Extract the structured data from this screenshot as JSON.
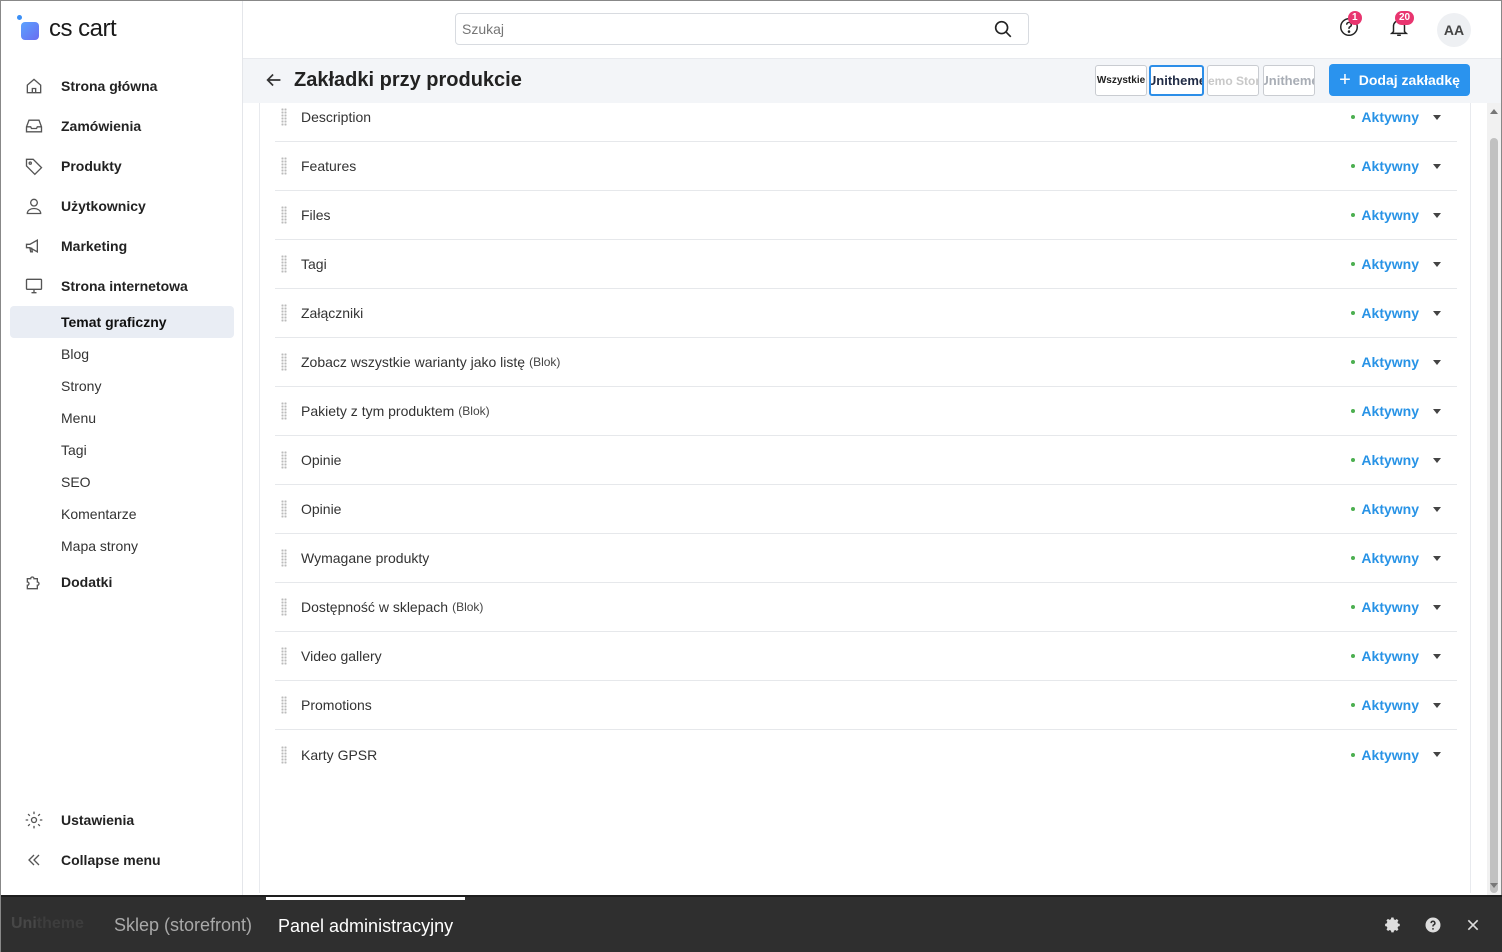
{
  "app": {
    "logo_text": "cs cart"
  },
  "sidebar": {
    "items": [
      {
        "label": "Strona główna",
        "icon": "home-icon"
      },
      {
        "label": "Zamówienia",
        "icon": "inbox-icon"
      },
      {
        "label": "Produkty",
        "icon": "tag-icon"
      },
      {
        "label": "Użytkownicy",
        "icon": "user-icon"
      },
      {
        "label": "Marketing",
        "icon": "megaphone-icon"
      },
      {
        "label": "Strona internetowa",
        "icon": "monitor-icon"
      }
    ],
    "sub_items": [
      "Temat graficzny",
      "Blog",
      "Strony",
      "Menu",
      "Tagi",
      "SEO",
      "Komentarze",
      "Mapa strony"
    ],
    "addons": {
      "label": "Dodatki",
      "icon": "puzzle-icon"
    },
    "settings": {
      "label": "Ustawienia",
      "icon": "gear-icon"
    },
    "collapse": {
      "label": "Collapse menu",
      "icon": "double-chevron-left-icon"
    }
  },
  "topbar": {
    "search_placeholder": "Szukaj",
    "help_badge": "1",
    "notifications_badge": "20",
    "avatar_initials": "AA"
  },
  "titlebar": {
    "title": "Zakładki przy produkcie",
    "theme_buttons": [
      "Wszystkie",
      "Unitheme",
      "Demo Store",
      "Unitheme"
    ],
    "add_button": "Dodaj zakładkę"
  },
  "tabs": [
    {
      "name": "Description",
      "blok": "",
      "status": "Aktywny"
    },
    {
      "name": "Features",
      "blok": "",
      "status": "Aktywny"
    },
    {
      "name": "Files",
      "blok": "",
      "status": "Aktywny"
    },
    {
      "name": "Tagi",
      "blok": "",
      "status": "Aktywny"
    },
    {
      "name": "Załączniki",
      "blok": "",
      "status": "Aktywny"
    },
    {
      "name": "Zobacz wszystkie warianty jako listę",
      "blok": "(Blok)",
      "status": "Aktywny"
    },
    {
      "name": "Pakiety z tym produktem",
      "blok": "(Blok)",
      "status": "Aktywny"
    },
    {
      "name": "Opinie",
      "blok": "",
      "status": "Aktywny"
    },
    {
      "name": "Opinie",
      "blok": "",
      "status": "Aktywny"
    },
    {
      "name": "Wymagane produkty",
      "blok": "",
      "status": "Aktywny"
    },
    {
      "name": "Dostępność w sklepach",
      "blok": "(Blok)",
      "status": "Aktywny"
    },
    {
      "name": "Video gallery",
      "blok": "",
      "status": "Aktywny"
    },
    {
      "name": "Promotions",
      "blok": "",
      "status": "Aktywny"
    },
    {
      "name": "Karty GPSR",
      "blok": "",
      "status": "Aktywny"
    }
  ],
  "bottombar": {
    "brand_prefix": "Uni",
    "brand_suffix": "theme",
    "storefront_tab": "Sklep (storefront)",
    "admin_tab": "Panel administracyjny"
  },
  "colors": {
    "accent": "#2a93ee",
    "status_dot": "#4caf50",
    "badge": "#e8356f"
  }
}
